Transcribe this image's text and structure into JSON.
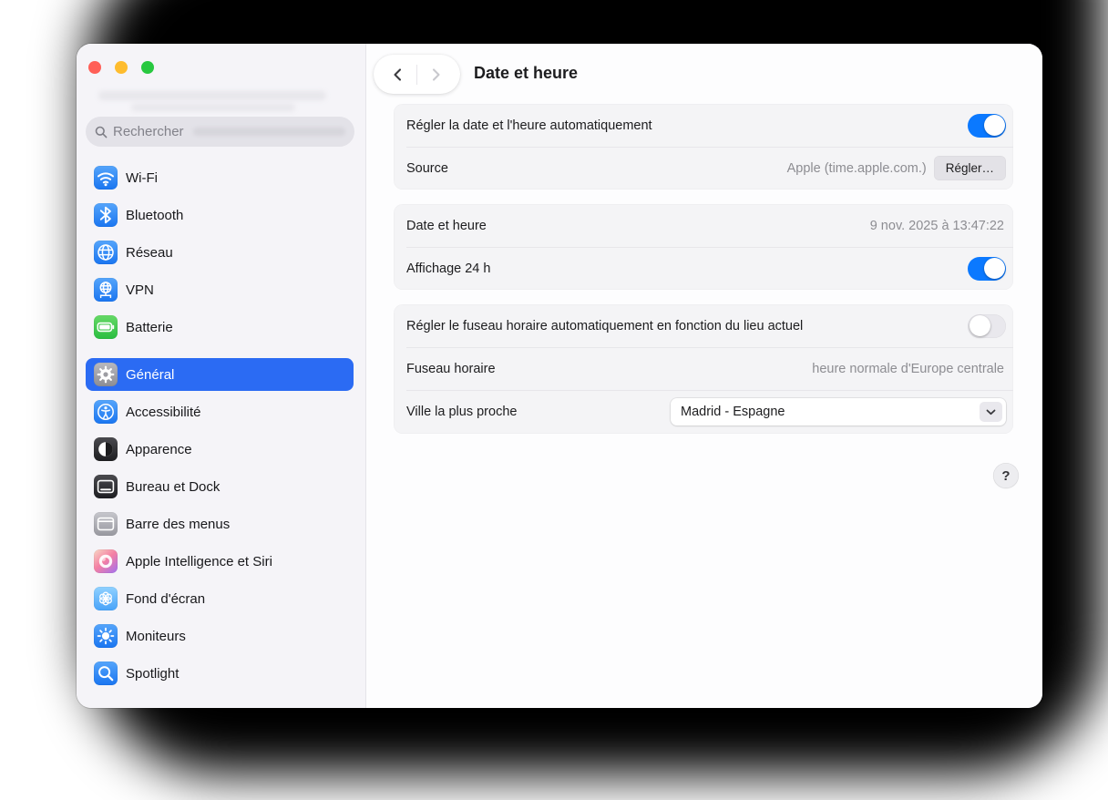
{
  "colors": {
    "accent_blue": "#0b79ff",
    "selection_blue": "#2b6bf3",
    "traffic_red": "#ff5f57",
    "traffic_yellow": "#febc2e",
    "traffic_green": "#28c840"
  },
  "sidebar": {
    "search_placeholder": "Rechercher",
    "items": [
      {
        "label": "Wi-Fi",
        "icon": "wifi-icon",
        "bg": "bg-blue"
      },
      {
        "label": "Bluetooth",
        "icon": "bluetooth-icon",
        "bg": "bg-blue"
      },
      {
        "label": "Réseau",
        "icon": "globe-icon",
        "bg": "bg-blue"
      },
      {
        "label": "VPN",
        "icon": "vpn-globe-icon",
        "bg": "bg-blue"
      },
      {
        "label": "Batterie",
        "icon": "battery-icon",
        "bg": "bg-green"
      },
      {
        "label": "Général",
        "icon": "gear-icon",
        "bg": "bg-gray",
        "selected": true,
        "gap_before": true
      },
      {
        "label": "Accessibilité",
        "icon": "accessibility-icon",
        "bg": "bg-blue"
      },
      {
        "label": "Apparence",
        "icon": "appearance-contrast-icon",
        "bg": "bg-dark"
      },
      {
        "label": "Bureau et Dock",
        "icon": "desktop-dock-icon",
        "bg": "bg-dark"
      },
      {
        "label": "Barre des menus",
        "icon": "menu-bar-icon",
        "bg": "bg-midgray"
      },
      {
        "label": "Apple Intelligence et Siri",
        "icon": "siri-swirl-icon",
        "bg": "bg-ai"
      },
      {
        "label": "Fond d'écran",
        "icon": "wallpaper-flower-icon",
        "bg": "bg-lightblue"
      },
      {
        "label": "Moniteurs",
        "icon": "brightness-sun-icon",
        "bg": "bg-blue"
      },
      {
        "label": "Spotlight",
        "icon": "magnifier-icon",
        "bg": "bg-blue"
      }
    ]
  },
  "header": {
    "title": "Date et heure"
  },
  "groups": [
    {
      "rows": [
        {
          "type": "toggle",
          "label": "Régler la date et l'heure automatiquement",
          "value": true
        },
        {
          "type": "value-button",
          "label": "Source",
          "value": "Apple (time.apple.com.)",
          "button": "Régler…"
        }
      ]
    },
    {
      "rows": [
        {
          "type": "value",
          "label": "Date et heure",
          "value": "9 nov. 2025 à 13:47:22"
        },
        {
          "type": "toggle",
          "label": "Affichage 24 h",
          "value": true
        }
      ]
    },
    {
      "rows": [
        {
          "type": "toggle",
          "label": "Régler le fuseau horaire automatiquement en fonction du lieu actuel",
          "value": false
        },
        {
          "type": "value",
          "label": "Fuseau horaire",
          "value": "heure normale d'Europe centrale"
        },
        {
          "type": "select",
          "label": "Ville la plus proche",
          "value": "Madrid - Espagne"
        }
      ]
    }
  ],
  "help": {
    "label": "?"
  }
}
